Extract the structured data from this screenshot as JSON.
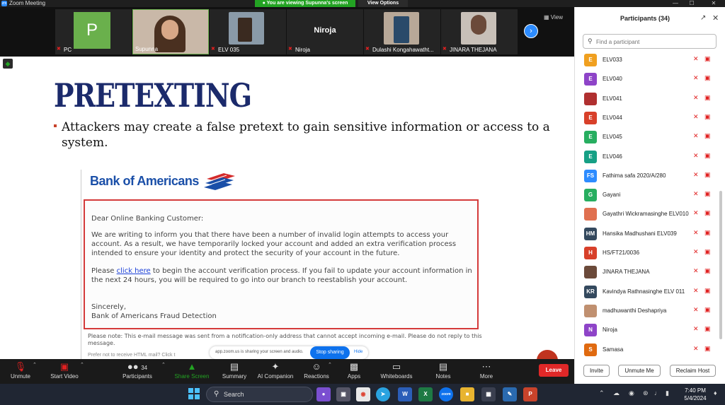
{
  "window": {
    "title": "Zoom Meeting",
    "app_icon": "zm",
    "share_banner": "You are viewing Supunna's screen",
    "view_options": "View Options",
    "controls": [
      "—",
      "☐",
      "✕"
    ]
  },
  "video_strip": {
    "tiles": [
      {
        "label": "PC",
        "avatar_letter": "P",
        "muted": true
      },
      {
        "label": "Supunna",
        "muted": false
      },
      {
        "label": "ELV 035",
        "muted": true
      },
      {
        "label": "Niroja",
        "big_name": "Niroja",
        "muted": true
      },
      {
        "label": "Dulashi Kongahawatht...",
        "muted": true
      },
      {
        "label": "JINARA THEJANA",
        "muted": true
      }
    ],
    "view_label": "View",
    "next_arrow": "›"
  },
  "slide": {
    "title": "PRETEXTING",
    "bullet": "Attackers may create a false pretext to gain sensitive information or access to a system.",
    "email": {
      "logo": "Bank of Americans",
      "greeting": "Dear Online Banking Customer:",
      "para1": "We are writing to inform you that there have been a number of invalid login attempts to access your account.  As a result, we have temporarily locked your account and added an extra verification process intended to ensure your identity and protect the security of your account in the future.",
      "para2_before": "Please ",
      "para2_link": "click here",
      "para2_after": " to begin the account verification process. If you fail to update your account information in the next 24 hours, you will be required to go into our branch to reestablish your account.",
      "sign1": "Sincerely,",
      "sign2": "Bank of Americans Fraud Detection",
      "note": "Please note: This e-mail message was sent from a notification-only address that cannot accept incoming e-mail. Please do not reply to this message.",
      "note2": "Prefer not to receive HTML mail?  Click t"
    },
    "share_pill_text": "app.zoom.us is sharing your screen and audio.",
    "stop_sharing": "Stop sharing",
    "hide": "Hide"
  },
  "participants": {
    "title": "Participants (34)",
    "search_placeholder": "Find a participant",
    "list": [
      {
        "name": "ELV033",
        "initials": "E",
        "color": "#f0a020"
      },
      {
        "name": "ELV040",
        "initials": "E",
        "color": "#8e44c8"
      },
      {
        "name": "ELV041",
        "initials": "",
        "color": "#b03030"
      },
      {
        "name": "ELV044",
        "initials": "E",
        "color": "#d8402a"
      },
      {
        "name": "ELV045",
        "initials": "E",
        "color": "#27ae60"
      },
      {
        "name": "ELV046",
        "initials": "E",
        "color": "#16a085"
      },
      {
        "name": "Fathima safa 2020/A/280",
        "initials": "FS",
        "color": "#2d8cff"
      },
      {
        "name": "Gayani",
        "initials": "G",
        "color": "#27ae60"
      },
      {
        "name": "Gayathri Wickramasinghe ELV010",
        "initials": "",
        "color": "#e07050"
      },
      {
        "name": "Hansika Madhushani ELV039",
        "initials": "HM",
        "color": "#34495e"
      },
      {
        "name": "HS/FT21/0036",
        "initials": "H",
        "color": "#d8402a"
      },
      {
        "name": "JINARA THEJANA",
        "initials": "",
        "color": "#6b4a3a"
      },
      {
        "name": "Kavindya Rathnasinghe ELV 011",
        "initials": "KR",
        "color": "#34495e"
      },
      {
        "name": "madhuwanthi Deshapriya",
        "initials": "",
        "color": "#c09070"
      },
      {
        "name": "Niroja",
        "initials": "N",
        "color": "#8e44c8"
      },
      {
        "name": "Samasa",
        "initials": "S",
        "color": "#e06a10"
      }
    ],
    "buttons": {
      "invite": "Invite",
      "unmute_me": "Unmute Me",
      "reclaim_host": "Reclaim Host"
    }
  },
  "toolbar": {
    "unmute": "Unmute",
    "start_video": "Start Video",
    "participants": "Participants",
    "participants_count": "34",
    "share_screen": "Share Screen",
    "summary": "Summary",
    "ai_companion": "AI Companion",
    "reactions": "Reactions",
    "apps": "Apps",
    "whiteboards": "Whiteboards",
    "notes": "Notes",
    "more": "More",
    "leave": "Leave"
  },
  "taskbar": {
    "search": "Search",
    "time": "7:40 PM",
    "date": "5/4/2024"
  },
  "colors": {
    "zoom_blue": "#2d8cff",
    "share_green": "#23a323",
    "leave_red": "#e02828",
    "slide_title": "#1b2a6b",
    "email_border": "#d43a3a"
  }
}
